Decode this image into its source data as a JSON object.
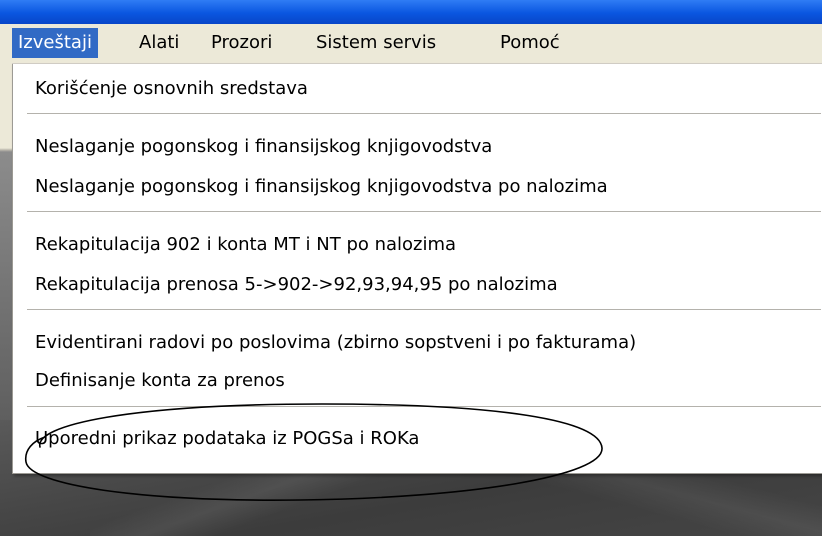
{
  "menubar": {
    "items": [
      {
        "label": "Izveštaji",
        "active": true
      },
      {
        "label": "Alati",
        "active": false
      },
      {
        "label": "Prozori",
        "active": false
      },
      {
        "label": "Sistem servis",
        "active": false
      },
      {
        "label": "Pomoć",
        "active": false
      }
    ]
  },
  "dropdown": {
    "groups": [
      {
        "items": [
          "Korišćenje osnovnih sredstava"
        ]
      },
      {
        "items": [
          "Neslaganje pogonskog i finansijskog knjigovodstva",
          "Neslaganje pogonskog i finansijskog knjigovodstva po nalozima"
        ]
      },
      {
        "items": [
          "Rekapitulacija 902 i konta MT i NT po nalozima",
          "Rekapitulacija prenosa 5->902->92,93,94,95 po nalozima"
        ]
      },
      {
        "items": [
          "Evidentirani radovi po poslovima (zbirno sopstveni i po fakturama)",
          "Definisanje konta za prenos"
        ]
      },
      {
        "items": [
          "Uporedni prikaz podataka iz POGSa i ROKa"
        ]
      }
    ]
  },
  "colors": {
    "titlebar": "#0a56e0",
    "menu_bg": "#ece9d8",
    "highlight": "#316ac5",
    "annotation_stroke": "#000000"
  },
  "annotation": {
    "shape": "hand-drawn-ellipse"
  }
}
